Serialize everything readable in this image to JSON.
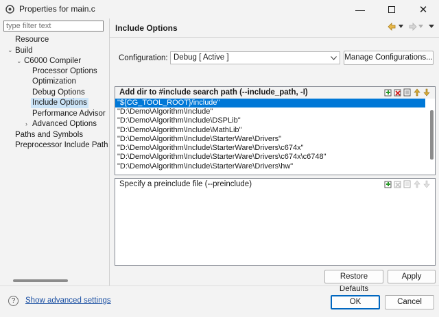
{
  "window": {
    "title": "Properties for main.c",
    "minimize_glyph": "—",
    "close_glyph": "✕"
  },
  "left": {
    "filter_placeholder": "type filter text",
    "tree": [
      {
        "label": "Resource",
        "twisty": ""
      },
      {
        "label": "Build",
        "twisty": "⌄"
      },
      {
        "label": "C6000 Compiler",
        "twisty": "⌄"
      },
      {
        "label": "Processor Options",
        "twisty": ""
      },
      {
        "label": "Optimization",
        "twisty": ""
      },
      {
        "label": "Debug Options",
        "twisty": ""
      },
      {
        "label": "Include Options",
        "twisty": "",
        "selected": true
      },
      {
        "label": "Performance Advisor",
        "twisty": ""
      },
      {
        "label": "Advanced Options",
        "twisty": "›"
      },
      {
        "label": "Paths and Symbols",
        "twisty": ""
      },
      {
        "label": "Preprocessor Include Paths",
        "twisty": ""
      }
    ]
  },
  "main": {
    "title": "Include Options",
    "config_label": "Configuration:",
    "config_value": "Debug  [ Active ]",
    "manage_button": "Manage Configurations...",
    "include_panel": {
      "heading": "Add dir to #include search path (--include_path, -I)",
      "items": [
        "\"${CG_TOOL_ROOT}/include\"",
        "\"D:\\Demo\\Algorithm\\Include\"",
        "\"D:\\Demo\\Algorithm\\Include\\DSPLib\"",
        "\"D:\\Demo\\Algorithm\\Include\\MathLib\"",
        "\"D:\\Demo\\Algorithm\\Include\\StarterWare\\Drivers\"",
        "\"D:\\Demo\\Algorithm\\Include\\StarterWare\\Drivers\\c674x\"",
        "\"D:\\Demo\\Algorithm\\Include\\StarterWare\\Drivers\\c674x\\c6748\"",
        "\"D:\\Demo\\Algorithm\\Include\\StarterWare\\Drivers\\hw\""
      ]
    },
    "preinclude_panel": {
      "heading": "Specify a preinclude file (--preinclude)"
    },
    "restore_button": "Restore Defaults",
    "apply_button": "Apply"
  },
  "footer": {
    "help_glyph": "?",
    "advanced_link": "Show advanced settings",
    "ok_button": "OK",
    "cancel_button": "Cancel"
  },
  "colors": {
    "selection": "#0078d7",
    "tree_selection": "#cce4f7",
    "link": "#1a4fa3",
    "default_button_border": "#0067c0"
  }
}
